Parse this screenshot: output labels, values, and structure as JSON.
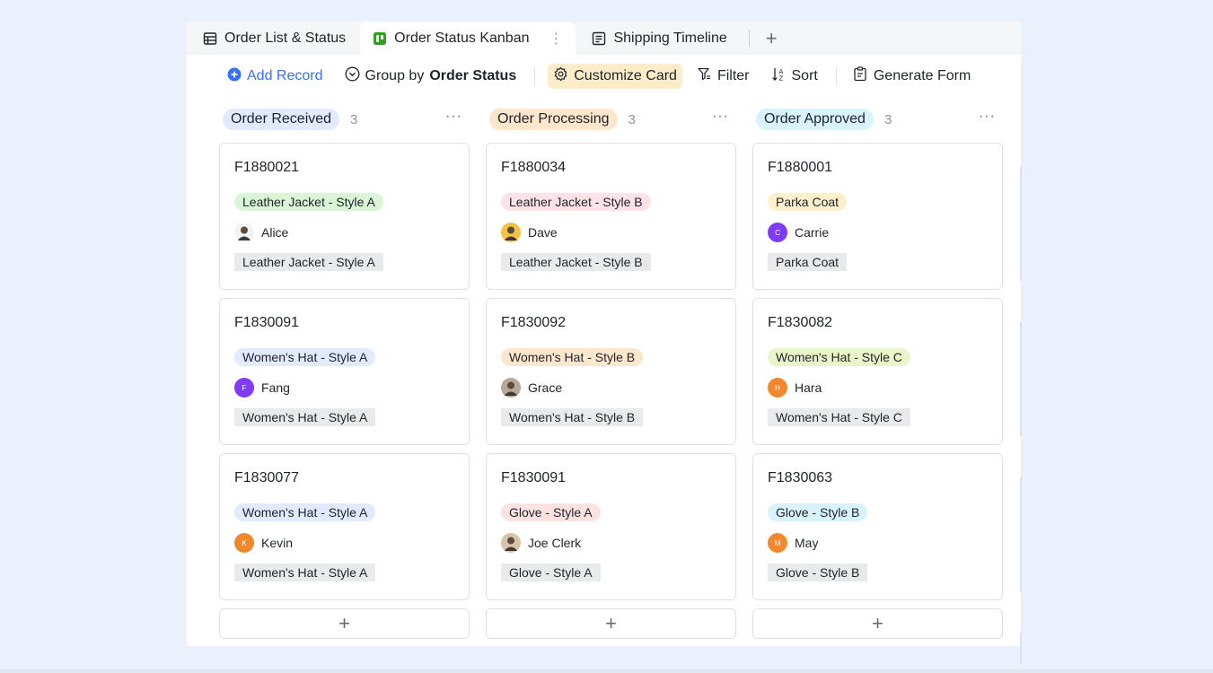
{
  "tabs": [
    {
      "label": "Order List & Status",
      "icon": "grid-table-icon"
    },
    {
      "label": "Order Status Kanban",
      "icon": "kanban-icon",
      "active": true
    },
    {
      "label": "Shipping Timeline",
      "icon": "timeline-icon"
    }
  ],
  "tab_more": "⋮",
  "tab_add": "+",
  "toolbar": {
    "add_record": "Add Record",
    "group_prefix": "Group by",
    "group_field": "Order Status",
    "customize_card": "Customize Card",
    "filter": "Filter",
    "sort": "Sort",
    "generate_form": "Generate Form"
  },
  "colors": {
    "accent": "#3370ff",
    "highlight": "#fcedc8"
  },
  "columns": [
    {
      "title": "Order Received",
      "count": "3",
      "pill_color": "#e1eaff",
      "more": "···",
      "cards": [
        {
          "id": "F1880021",
          "tag": "Leather Jacket - Style A",
          "tag_color": "#d9f5d6",
          "person": "Alice",
          "avatar_color": "#f2f3f5",
          "avatar_letter": "",
          "avatar_kind": "photo",
          "field": "Leather Jacket - Style A"
        },
        {
          "id": "F1830091",
          "tag": "Women's Hat - Style A",
          "tag_color": "#e1eaff",
          "person": "Fang",
          "avatar_color": "#7f3bf5",
          "avatar_letter": "F",
          "field": "Women's Hat - Style A"
        },
        {
          "id": "F1830077",
          "tag": "Women's Hat - Style A",
          "tag_color": "#e1eaff",
          "person": "Kevin",
          "avatar_color": "#f2882d",
          "avatar_letter": "K",
          "field": "Women's Hat - Style A"
        }
      ],
      "add": "+"
    },
    {
      "title": "Order Processing",
      "count": "3",
      "pill_color": "#fee7cd",
      "more": "···",
      "cards": [
        {
          "id": "F1880034",
          "tag": "Leather Jacket - Style B",
          "tag_color": "#fde2e8",
          "person": "Dave",
          "avatar_color": "#f5c344",
          "avatar_letter": "",
          "avatar_kind": "photo",
          "field": "Leather Jacket - Style B"
        },
        {
          "id": "F1830092",
          "tag": "Women's Hat - Style B",
          "tag_color": "#fee7cd",
          "person": "Grace",
          "avatar_color": "#b7a89a",
          "avatar_letter": "",
          "avatar_kind": "photo",
          "field": "Women's Hat - Style B"
        },
        {
          "id": "F1830091",
          "tag": "Glove - Style A",
          "tag_color": "#fde2e2",
          "person": "Joe Clerk",
          "avatar_color": "#d9c4a8",
          "avatar_letter": "",
          "avatar_kind": "photo",
          "field": "Glove - Style A"
        }
      ],
      "add": "+"
    },
    {
      "title": "Order Approved",
      "count": "3",
      "pill_color": "#d9f3fd",
      "more": "···",
      "cards": [
        {
          "id": "F1880001",
          "tag": "Parka Coat",
          "tag_color": "#fdf0cc",
          "person": "Carrie",
          "avatar_color": "#7f3bf5",
          "avatar_letter": "C",
          "field": "Parka Coat"
        },
        {
          "id": "F1830082",
          "tag": "Women's Hat - Style C",
          "tag_color": "#e8f5c8",
          "person": "Hara",
          "avatar_color": "#f2882d",
          "avatar_letter": "H",
          "field": "Women's Hat - Style C"
        },
        {
          "id": "F1830063",
          "tag": "Glove - Style B",
          "tag_color": "#d9f3fd",
          "person": "May",
          "avatar_color": "#f2882d",
          "avatar_letter": "M",
          "field": "Glove - Style B"
        }
      ],
      "add": "+"
    }
  ]
}
